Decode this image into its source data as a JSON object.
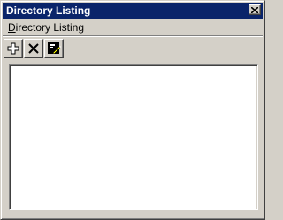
{
  "window": {
    "title": "Directory Listing",
    "title_bar_color": "#0a246a",
    "close_icon": "close-icon"
  },
  "menu": {
    "items": [
      {
        "label_underlined": "D",
        "label_rest": "irectory Listing"
      }
    ]
  },
  "toolbar": {
    "buttons": [
      {
        "icon": "add-icon"
      },
      {
        "icon": "delete-icon"
      },
      {
        "icon": "properties-icon"
      }
    ]
  },
  "list": {
    "items": []
  }
}
